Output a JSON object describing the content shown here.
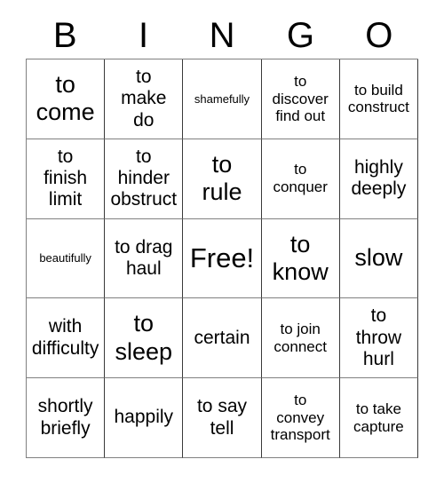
{
  "card": {
    "title": "BINGO",
    "background_color": "#ffffff",
    "text_color": "#000000",
    "border_color": "#808080"
  },
  "header": {
    "letters": [
      "B",
      "I",
      "N",
      "G",
      "O"
    ]
  },
  "grid": {
    "columns": 5,
    "rows": 5,
    "free_space": "Free!",
    "cells": [
      {
        "text": "to\ncome",
        "size": "lg"
      },
      {
        "text": "to\nmake\ndo",
        "size": "md"
      },
      {
        "text": "shamefully",
        "size": "xs"
      },
      {
        "text": "to\ndiscover\nfind out",
        "size": "sm"
      },
      {
        "text": "to build\nconstruct",
        "size": "sm"
      },
      {
        "text": "to\nfinish\nlimit",
        "size": "md"
      },
      {
        "text": "to\nhinder\nobstruct",
        "size": "md"
      },
      {
        "text": "to\nrule",
        "size": "lg"
      },
      {
        "text": "to\nconquer",
        "size": "sm"
      },
      {
        "text": "highly\ndeeply",
        "size": "md"
      },
      {
        "text": "beautifully",
        "size": "xs"
      },
      {
        "text": "to drag\nhaul",
        "size": "md"
      },
      {
        "text": "Free!",
        "size": "xl"
      },
      {
        "text": "to\nknow",
        "size": "lg"
      },
      {
        "text": "slow",
        "size": "lg"
      },
      {
        "text": "with\ndifficulty",
        "size": "md"
      },
      {
        "text": "to\nsleep",
        "size": "lg"
      },
      {
        "text": "certain",
        "size": "md"
      },
      {
        "text": "to join\nconnect",
        "size": "sm"
      },
      {
        "text": "to\nthrow\nhurl",
        "size": "md"
      },
      {
        "text": "shortly\nbriefly",
        "size": "md"
      },
      {
        "text": "happily",
        "size": "md"
      },
      {
        "text": "to say\ntell",
        "size": "md"
      },
      {
        "text": "to\nconvey\ntransport",
        "size": "sm"
      },
      {
        "text": "to take\ncapture",
        "size": "sm"
      }
    ]
  }
}
